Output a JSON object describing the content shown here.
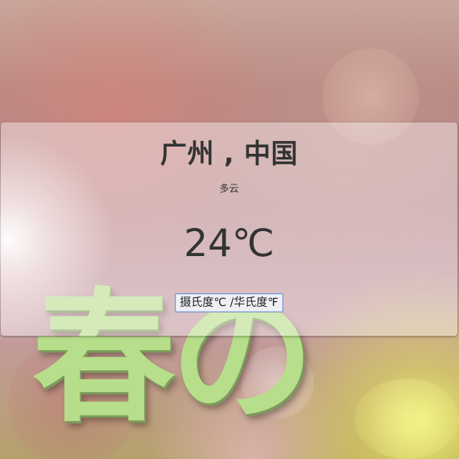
{
  "background": {
    "decorative_text": "春の"
  },
  "weather": {
    "location": "广州 , 中国",
    "condition": "多云",
    "temperature": "24℃"
  },
  "controls": {
    "unit_toggle_label": "摄氏度℃ /华氏度℉"
  },
  "colors": {
    "text": "#333333",
    "card_background": "rgba(255,255,255,0.4)",
    "button_border": "#7a96c8",
    "decorative_text": "#b7de8a"
  }
}
